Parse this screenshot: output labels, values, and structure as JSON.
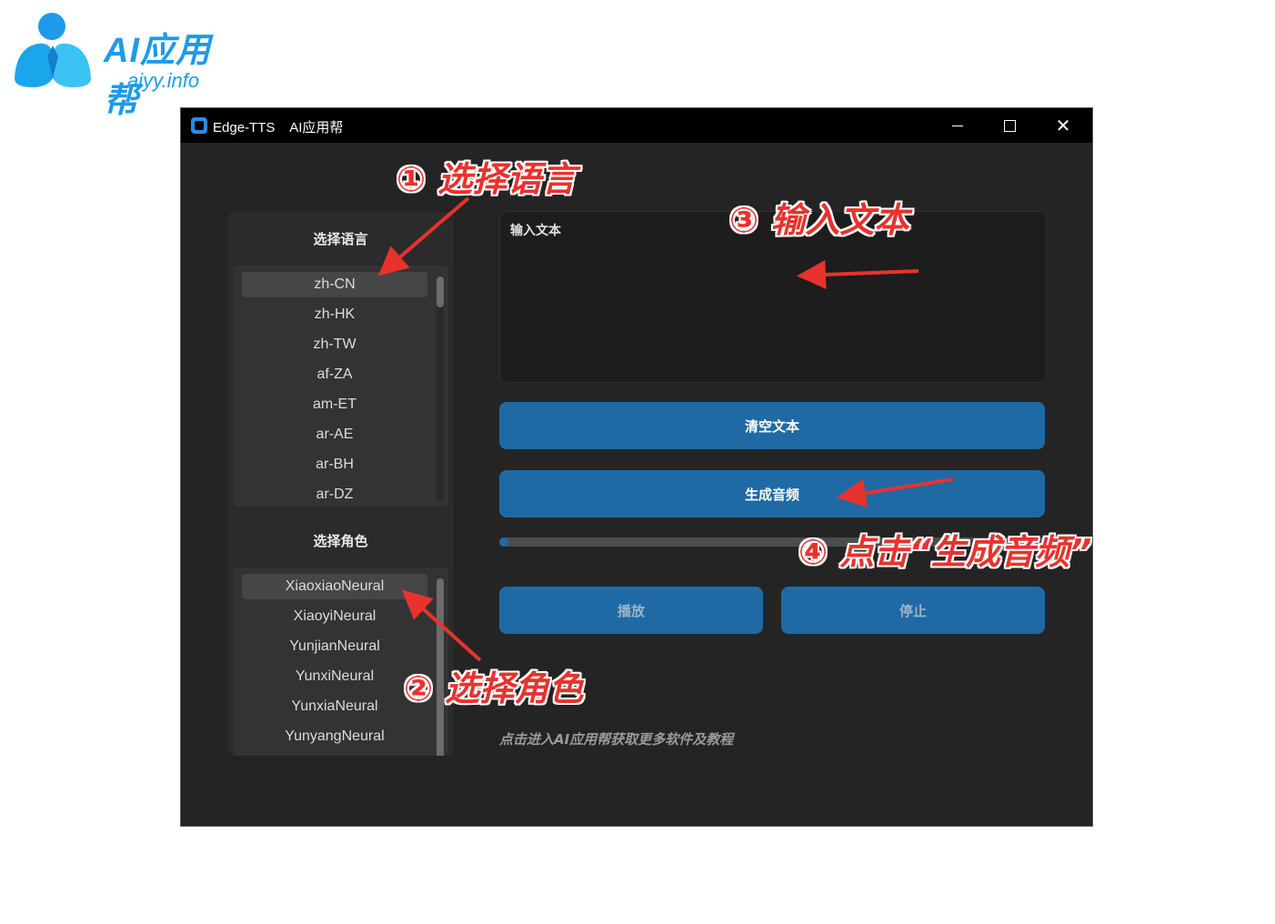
{
  "watermark": {
    "brand_title": "AI应用帮",
    "brand_sub": "aiyy.info"
  },
  "window": {
    "title": "Edge-TTS    AI应用帮",
    "controls": {
      "minimize": "minimize-icon",
      "maximize": "maximize-icon",
      "close": "close-icon"
    }
  },
  "left": {
    "language_label": "选择语言",
    "languages": [
      "zh-CN",
      "zh-HK",
      "zh-TW",
      "af-ZA",
      "am-ET",
      "ar-AE",
      "ar-BH",
      "ar-DZ"
    ],
    "selected_language": "zh-CN",
    "voice_label": "选择角色",
    "voices": [
      "XiaoxiaoNeural",
      "XiaoyiNeural",
      "YunjianNeural",
      "YunxiNeural",
      "YunxiaNeural",
      "YunyangNeural"
    ],
    "selected_voice": "XiaoxiaoNeural"
  },
  "main": {
    "text_placeholder": "输入文本",
    "clear_label": "清空文本",
    "generate_label": "生成音频",
    "play_label": "播放",
    "stop_label": "停止",
    "progress": 0.015,
    "footer_link": "点击进入AI应用帮获取更多软件及教程"
  },
  "annotations": {
    "step1": "① 选择语言",
    "step2": "② 选择角色",
    "step3": "③ 输入文本",
    "step4": "④ 点击“生成音频”"
  },
  "colors": {
    "accent": "#1f6aa5",
    "window_bg": "#242424",
    "annotation_red": "#e8322e",
    "brand_blue": "#1e9be8"
  }
}
